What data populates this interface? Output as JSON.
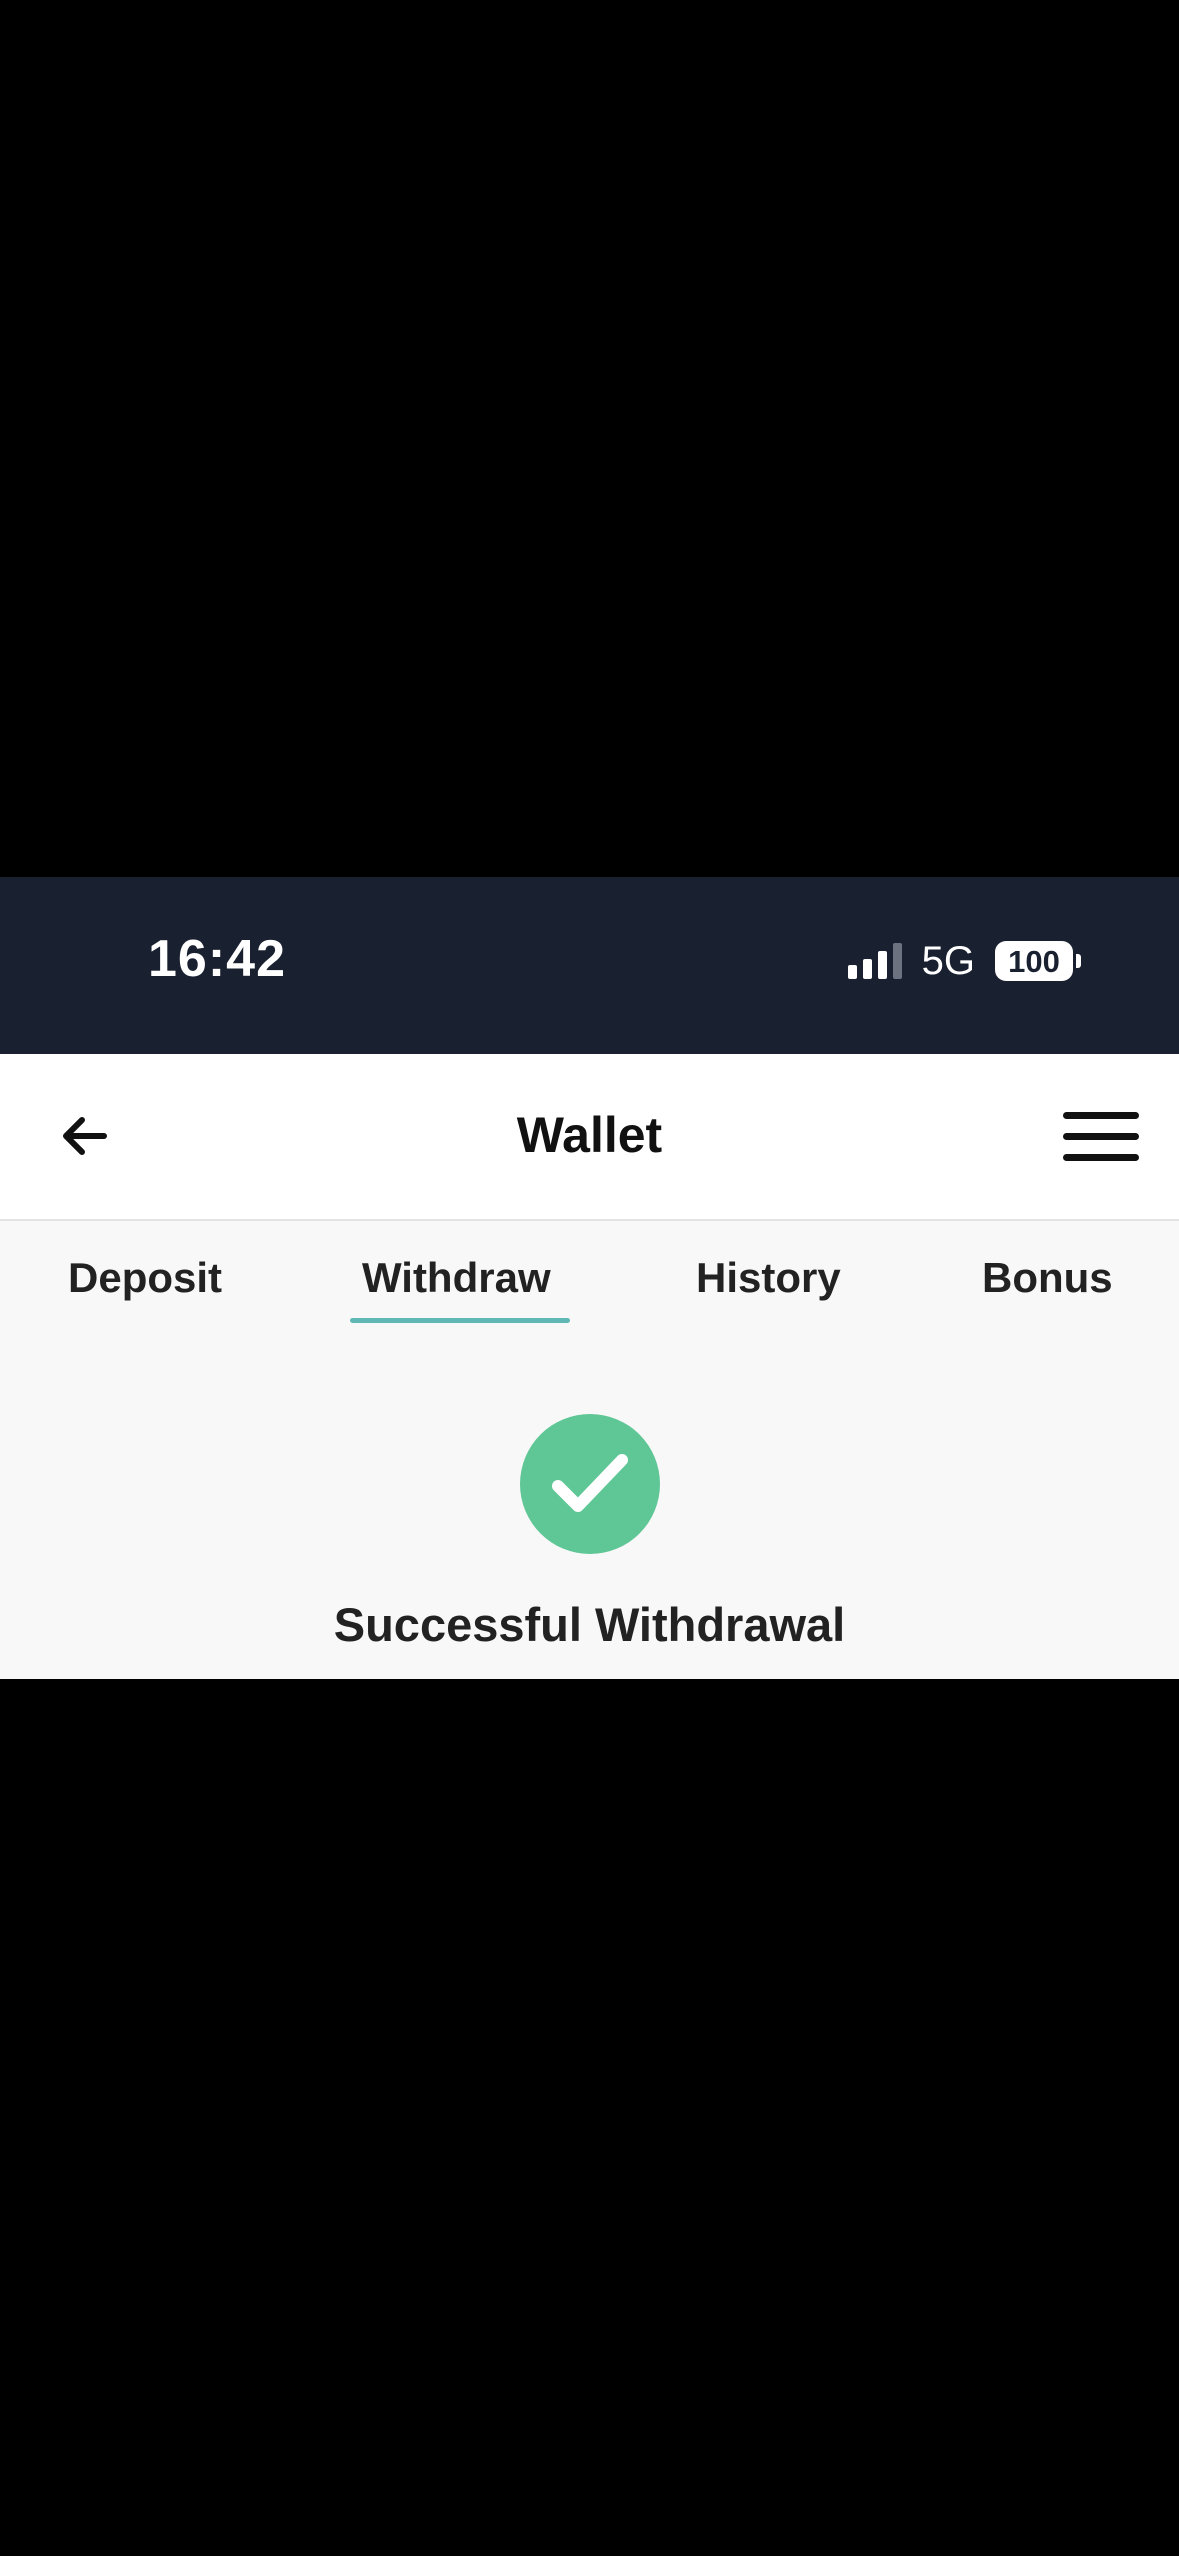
{
  "status_bar": {
    "time": "16:42",
    "network": "5G",
    "battery": "100",
    "signal_bars_active": 3,
    "signal_bars_total": 4
  },
  "nav": {
    "title": "Wallet",
    "back_icon": "arrow-left-icon",
    "menu_icon": "hamburger-menu-icon"
  },
  "tabs": [
    {
      "label": "Deposit",
      "active": false
    },
    {
      "label": "Withdraw",
      "active": true
    },
    {
      "label": "History",
      "active": false
    },
    {
      "label": "Bonus",
      "active": false
    }
  ],
  "result": {
    "icon": "check-circle-icon",
    "message": "Successful Withdrawal"
  },
  "colors": {
    "status_bar_bg": "#19202f",
    "tab_indicator": "#5fb8b4",
    "success_green": "#5fc696",
    "content_bg": "#f8f8f8"
  }
}
